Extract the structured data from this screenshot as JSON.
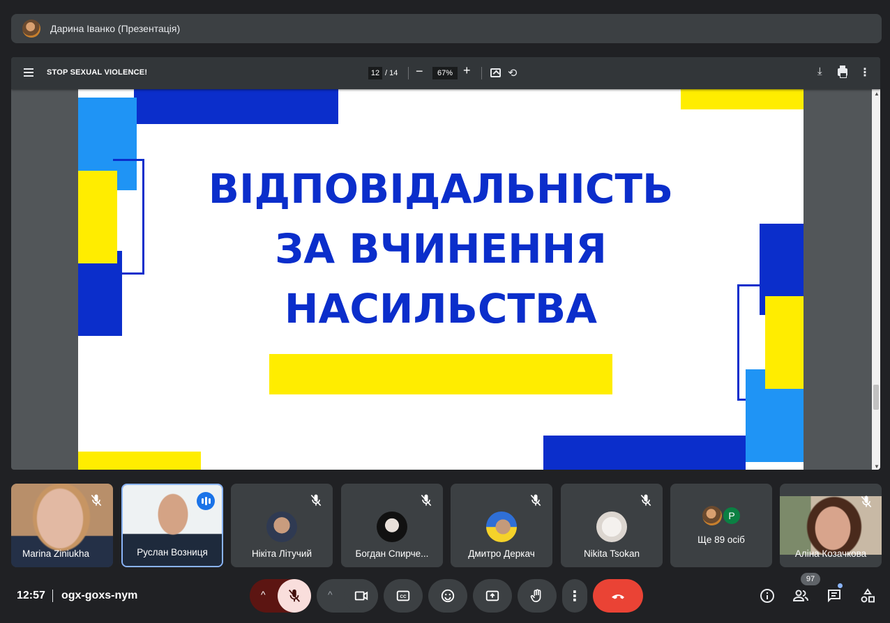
{
  "presenter": {
    "name": "Дарина Іванко (Презентація)"
  },
  "pdf": {
    "title": "STOP SEXUAL VIOLENCE!",
    "page_current": "12",
    "page_total": "/ 14",
    "zoom": "67%",
    "zoom_minus": "−",
    "zoom_plus": "+"
  },
  "slide": {
    "line1": "ВІДПОВІДАЛЬНІСТЬ",
    "line2": "ЗА ВЧИНЕННЯ",
    "line3": "НАСИЛЬСТВА",
    "colors": {
      "navy": "#0b2ecb",
      "sky": "#1f94f5",
      "yellow": "#ffed00"
    }
  },
  "participants": [
    {
      "name": "Marina Ziniukha",
      "muted": true
    },
    {
      "name": "Руслан Возниця",
      "speaking": true
    },
    {
      "name": "Нікіта Літучий",
      "muted": true
    },
    {
      "name": "Богдан Спирче...",
      "muted": true
    },
    {
      "name": "Дмитро Деркач",
      "muted": true
    },
    {
      "name": "Nikita Tsokan",
      "muted": true
    },
    {
      "name": "Ще 89 осіб",
      "avatar_letter": "P"
    },
    {
      "name": "Аліна Козачкова",
      "muted": true
    }
  ],
  "bottom_bar": {
    "time": "12:57",
    "meeting_code": "ogx-goxs-nym",
    "people_count": "97"
  }
}
